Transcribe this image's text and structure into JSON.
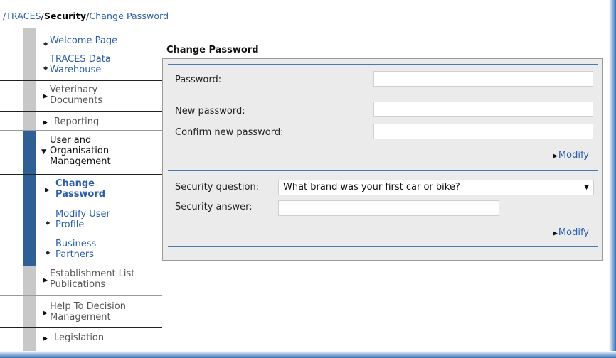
{
  "breadcrumb": {
    "root": "/TRACES",
    "sep1": "/",
    "middle": "Security",
    "sep2": "/",
    "current": "Change Password"
  },
  "sidebar": {
    "items": [
      {
        "label": "Welcome Page"
      },
      {
        "label_line1": "TRACES Data",
        "label_line2": "Warehouse"
      },
      {
        "label_line1": "Veterinary",
        "label_line2": "Documents"
      },
      {
        "label": "Reporting"
      },
      {
        "label_line1": "User and",
        "label_line2": "Organisation",
        "label_line3": "Management"
      },
      {
        "label_line1": "Change",
        "label_line2": "Password"
      },
      {
        "label_line1": "Modify User",
        "label_line2": "Profile"
      },
      {
        "label_line1": "Business",
        "label_line2": "Partners"
      },
      {
        "label_line1": "Establishment List",
        "label_line2": "Publications"
      },
      {
        "label_line1": "Help To Decision",
        "label_line2": "Management"
      },
      {
        "label": "Legislation"
      }
    ]
  },
  "main": {
    "title": "Change Password",
    "password_section": {
      "password_label": "Password:",
      "new_password_label": "New password:",
      "confirm_label": "Confirm new password:",
      "password_value": "",
      "new_password_value": "",
      "confirm_value": "",
      "modify_label": "Modify"
    },
    "security_section": {
      "question_label": "Security question:",
      "question_value": "What brand was your first car or bike?",
      "answer_label": "Security answer:",
      "answer_value": "",
      "modify_label": "Modify"
    }
  },
  "colors": {
    "link": "#2a5ea8",
    "accent_strip": "#2f5f94",
    "panel_bg": "#ebebeb"
  }
}
